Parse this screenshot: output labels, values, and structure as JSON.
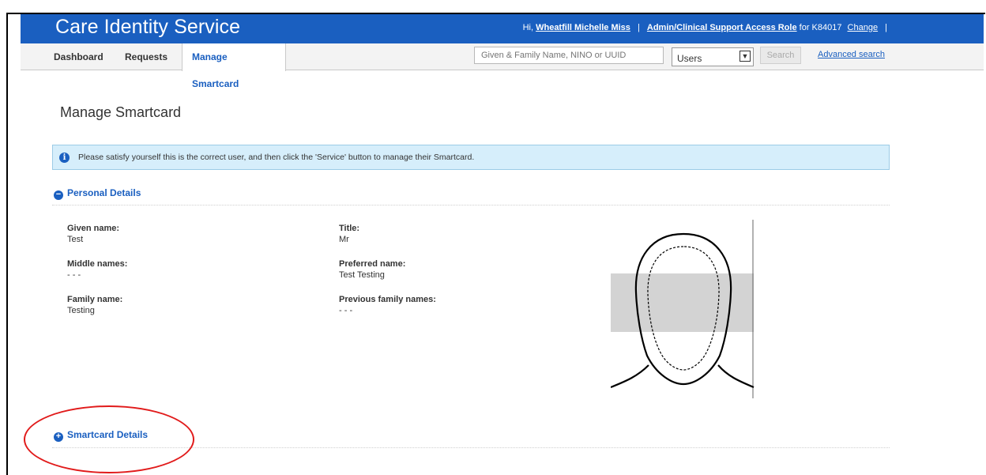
{
  "header": {
    "app_title": "Care Identity Service",
    "greeting": "Hi,",
    "user_name": "Wheatfill Michelle Miss",
    "role_link": "Admin/Clinical Support Access Role",
    "role_for": "for K84017",
    "change_label": "Change",
    "separator": "|"
  },
  "nav": {
    "tabs": [
      {
        "label": "Dashboard"
      },
      {
        "label": "Requests"
      },
      {
        "label": "Manage Smartcard"
      }
    ],
    "search_placeholder": "Given & Family Name, NINO or UUID",
    "search_type_selected": "Users",
    "search_button": "Search",
    "advanced_search": "Advanced search"
  },
  "page": {
    "title": "Manage Smartcard",
    "info_message": "Please satisfy yourself this is the correct user, and then click the 'Service' button to manage their Smartcard."
  },
  "personal_details": {
    "heading": "Personal Details",
    "collapse_symbol": "−",
    "fields": [
      {
        "label": "Given name:",
        "value": "Test"
      },
      {
        "label": "Middle names:",
        "value": "- - -"
      },
      {
        "label": "Family name:",
        "value": "Testing"
      },
      {
        "label": "Title:",
        "value": "Mr"
      },
      {
        "label": "Preferred name:",
        "value": "Test Testing"
      },
      {
        "label": "Previous family names:",
        "value": "- - -"
      }
    ]
  },
  "smartcard_details": {
    "heading": "Smartcard Details",
    "expand_symbol": "+"
  },
  "colors": {
    "brand_blue": "#1a5fc0",
    "annotation_red": "#e11b1b",
    "info_bg": "#d6eefb"
  },
  "icons": {
    "info": "info-icon",
    "collapse": "minus-circle-icon",
    "expand": "plus-circle-icon",
    "photo": "silhouette-placeholder-icon"
  }
}
